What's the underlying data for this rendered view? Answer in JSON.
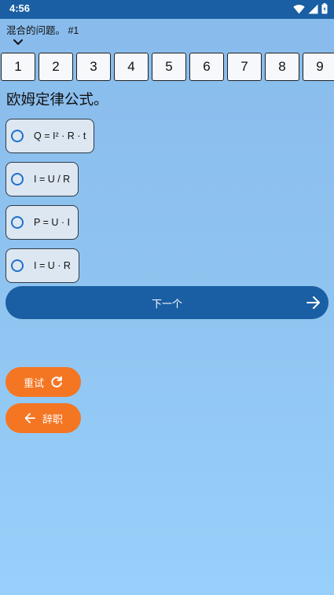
{
  "statusbar": {
    "time": "4:56"
  },
  "header": {
    "title": "混合的问题。 #1"
  },
  "question_nav": [
    "1",
    "2",
    "3",
    "4",
    "5",
    "6",
    "7",
    "8",
    "9"
  ],
  "question": {
    "text": "欧姆定律公式。"
  },
  "options": [
    {
      "label": "Q = I² · R · t"
    },
    {
      "label": "I = U / R"
    },
    {
      "label": "P = U · I"
    },
    {
      "label": "I = U · R"
    }
  ],
  "buttons": {
    "next": "下一个",
    "retry": "重试",
    "resign": "辞职"
  },
  "colors": {
    "primary": "#1a5fa3",
    "accent_orange": "#f47623",
    "radio_blue": "#1f6fcf"
  }
}
